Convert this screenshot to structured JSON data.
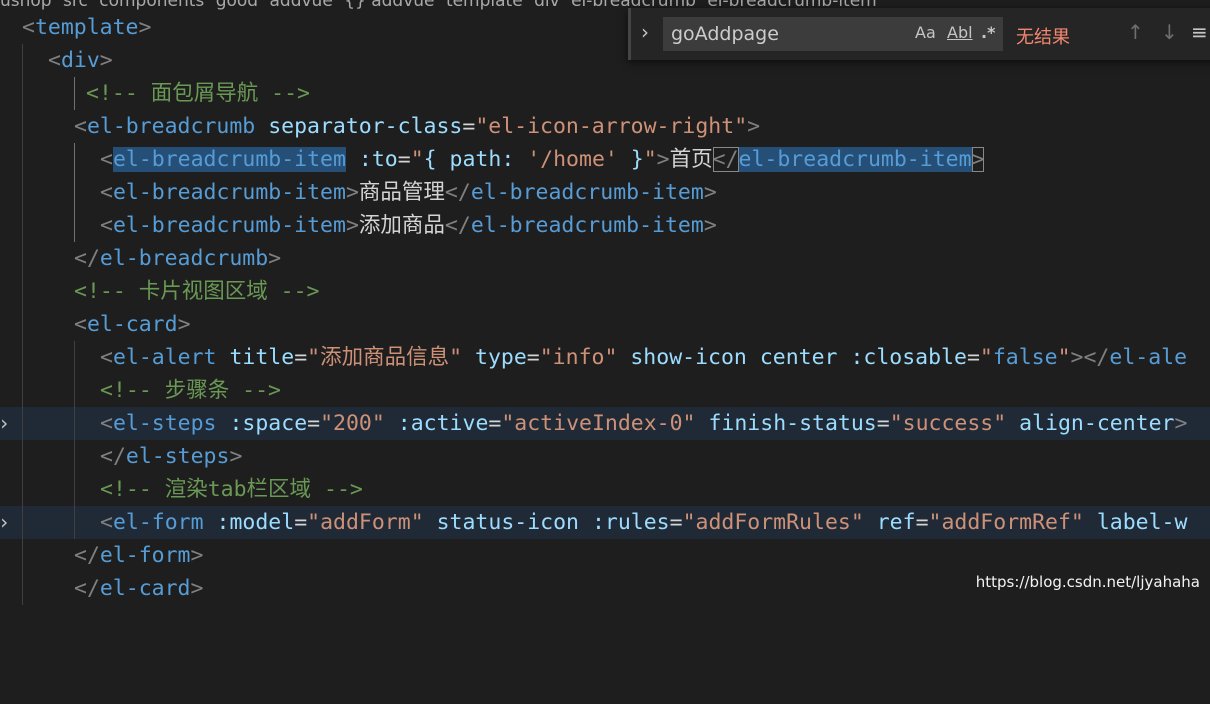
{
  "breadcrumb": [
    "ushop",
    "src",
    "components",
    "good",
    "addvue",
    "{} addvue",
    "template",
    "div",
    "el-breadcrumb",
    "el-breadcrumb-item"
  ],
  "find": {
    "query": "goAddpage",
    "match_case": "Aa",
    "whole_word": "Abl",
    "regex": ".*",
    "status": "无结果"
  },
  "code": {
    "l1": {
      "open": "<",
      "tag": "template",
      "close": ">"
    },
    "l2": {
      "open": "<",
      "tag": "div",
      "close": ">"
    },
    "l3": {
      "comment": "<!-- 面包屑导航 -->"
    },
    "l4": {
      "open": "<",
      "tag": "el-breadcrumb",
      "attr1": "separator-class",
      "eq1": "=",
      "val1": "\"el-icon-arrow-right\"",
      "close": ">"
    },
    "l5": {
      "open": "<",
      "tag": "el-breadcrumb-item",
      "attr1": ":to",
      "eq1": "=",
      "val1a": "\"",
      "val1b": "{ path: ",
      "val1c": "'/home'",
      "val1d": " }",
      "val1e": "\"",
      "close": ">",
      "text": "首页",
      "endopen": "</",
      "endtag_a": "el-breadcrumb-item",
      "endtag_b": "-item",
      "endclose": ">"
    },
    "l6": {
      "open": "<",
      "tag": "el-breadcrumb-item",
      "close": ">",
      "text": "商品管理",
      "endopen": "</",
      "endtag": "el-breadcrumb-item",
      "endclose": ">"
    },
    "l7": {
      "open": "<",
      "tag": "el-breadcrumb-item",
      "close": ">",
      "text": "添加商品",
      "endopen": "</",
      "endtag": "el-breadcrumb-item",
      "endclose": ">"
    },
    "l8": {
      "open": "</",
      "tag": "el-breadcrumb",
      "close": ">"
    },
    "l9": {
      "comment": "<!-- 卡片视图区域 -->"
    },
    "l10": {
      "open": "<",
      "tag": "el-card",
      "close": ">"
    },
    "l11": {
      "open": "<",
      "tag": "el-alert",
      "attr1": "title",
      "val1": "\"添加商品信息\"",
      "attr2": "type",
      "val2": "\"info\"",
      "attr3": "show-icon",
      "attr4": "center",
      "attr5": ":closable",
      "val5a": "\"",
      "val5b": "false",
      "val5c": "\"",
      "close": "></",
      "endtag": "el-ale"
    },
    "l12": {
      "comment": "<!-- 步骤条 -->"
    },
    "l13": {
      "open": "<",
      "tag": "el-steps",
      "attr1": ":space",
      "val1": "\"200\"",
      "attr2": ":active",
      "val2": "\"activeIndex-0\"",
      "attr3": "finish-status",
      "val3": "\"success\"",
      "attr4": "align-center",
      "close": ">"
    },
    "l14": {
      "open": "</",
      "tag": "el-steps",
      "close": ">"
    },
    "l15": {
      "comment": "<!-- 渲染tab栏区域 -->"
    },
    "l16": {
      "open": "<",
      "tag": "el-form",
      "attr1": ":model",
      "val1": "\"addForm\"",
      "attr2": "status-icon",
      "attr3": ":rules",
      "val3": "\"addFormRules\"",
      "attr4": "ref",
      "val4": "\"addFormRef\"",
      "attr5": "label-w"
    },
    "l17": {
      "open": "</",
      "tag": "el-form",
      "close": ">"
    },
    "l18": {
      "open": "</",
      "tag": "el-card",
      "close": ">"
    }
  },
  "watermark": "https://blog.csdn.net/ljyahaha"
}
